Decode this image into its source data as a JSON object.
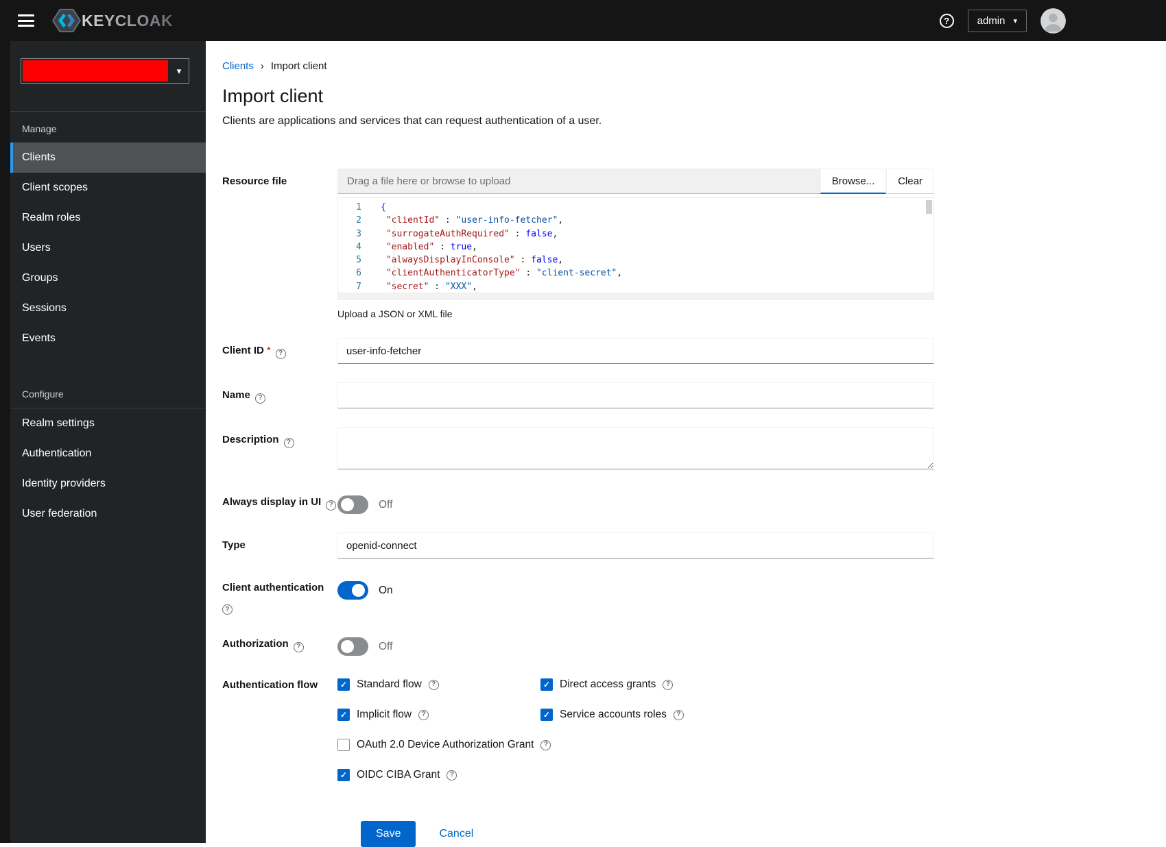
{
  "colors": {
    "accent": "#0066cc",
    "masthead_bg": "#151515",
    "sidebar_bg": "#212427",
    "sidebar_selected_bg": "#4f5255",
    "sidebar_selected_border": "#2b9af3",
    "realm_redaction": "#fe0000",
    "toggle_on": "#0066cc",
    "toggle_off": "#8a8d90",
    "required_star": "#c9190b",
    "code_key": "#a31515",
    "code_string": "#0451a5",
    "code_keyword": "#0000ff",
    "code_brace": "#0431fa",
    "code_line_number": "#237893"
  },
  "icons": {
    "caret_down": "▾",
    "breadcrumb_chevron": "›",
    "help": "?",
    "check": "✓"
  },
  "header": {
    "brand": "KEYCLOAK",
    "user_menu_label": "admin"
  },
  "sidebar": {
    "sections": [
      {
        "title": "Manage",
        "items": [
          {
            "label": "Clients",
            "selected": true
          },
          {
            "label": "Client scopes"
          },
          {
            "label": "Realm roles"
          },
          {
            "label": "Users"
          },
          {
            "label": "Groups"
          },
          {
            "label": "Sessions"
          },
          {
            "label": "Events"
          }
        ]
      },
      {
        "title": "Configure",
        "items": [
          {
            "label": "Realm settings"
          },
          {
            "label": "Authentication"
          },
          {
            "label": "Identity providers"
          },
          {
            "label": "User federation"
          }
        ]
      }
    ]
  },
  "breadcrumb": {
    "parent": "Clients",
    "current": "Import client"
  },
  "page": {
    "title": "Import client",
    "subtitle": "Clients are applications and services that can request authentication of a user."
  },
  "form": {
    "resource_file": {
      "label": "Resource file",
      "placeholder": "Drag a file here or browse to upload",
      "browse_label": "Browse...",
      "clear_label": "Clear",
      "helper_text": "Upload a JSON or XML file",
      "code_lines": [
        {
          "num": "1",
          "tokens": [
            {
              "t": "b",
              "v": "{"
            }
          ]
        },
        {
          "num": "2",
          "tokens": [
            {
              "t": "p",
              "v": " "
            },
            {
              "t": "k",
              "v": "\"clientId\""
            },
            {
              "t": "p",
              "v": " : "
            },
            {
              "t": "s",
              "v": "\"user-info-fetcher\""
            },
            {
              "t": "p",
              "v": ","
            }
          ]
        },
        {
          "num": "3",
          "tokens": [
            {
              "t": "p",
              "v": " "
            },
            {
              "t": "k",
              "v": "\"surrogateAuthRequired\""
            },
            {
              "t": "p",
              "v": " : "
            },
            {
              "t": "w",
              "v": "false"
            },
            {
              "t": "p",
              "v": ","
            }
          ]
        },
        {
          "num": "4",
          "tokens": [
            {
              "t": "p",
              "v": " "
            },
            {
              "t": "k",
              "v": "\"enabled\""
            },
            {
              "t": "p",
              "v": " : "
            },
            {
              "t": "w",
              "v": "true"
            },
            {
              "t": "p",
              "v": ","
            }
          ]
        },
        {
          "num": "5",
          "tokens": [
            {
              "t": "p",
              "v": " "
            },
            {
              "t": "k",
              "v": "\"alwaysDisplayInConsole\""
            },
            {
              "t": "p",
              "v": " : "
            },
            {
              "t": "w",
              "v": "false"
            },
            {
              "t": "p",
              "v": ","
            }
          ]
        },
        {
          "num": "6",
          "tokens": [
            {
              "t": "p",
              "v": " "
            },
            {
              "t": "k",
              "v": "\"clientAuthenticatorType\""
            },
            {
              "t": "p",
              "v": " : "
            },
            {
              "t": "s",
              "v": "\"client-secret\""
            },
            {
              "t": "p",
              "v": ","
            }
          ]
        },
        {
          "num": "7",
          "tokens": [
            {
              "t": "p",
              "v": " "
            },
            {
              "t": "k",
              "v": "\"secret\""
            },
            {
              "t": "p",
              "v": " : "
            },
            {
              "t": "s",
              "v": "\"XXX\""
            },
            {
              "t": "p",
              "v": ","
            }
          ]
        }
      ]
    },
    "client_id": {
      "label": "Client ID",
      "required_indicator": "*",
      "value": "user-info-fetcher"
    },
    "name": {
      "label": "Name",
      "value": ""
    },
    "description": {
      "label": "Description",
      "value": ""
    },
    "always_display_in_ui": {
      "label": "Always display in UI",
      "state": "Off"
    },
    "type": {
      "label": "Type",
      "value": "openid-connect"
    },
    "client_authentication": {
      "label": "Client authentication",
      "state": "On"
    },
    "authorization": {
      "label": "Authorization",
      "state": "Off"
    },
    "authentication_flow": {
      "label": "Authentication flow",
      "options": [
        {
          "label": "Standard flow",
          "checked": true
        },
        {
          "label": "Direct access grants",
          "checked": true
        },
        {
          "label": "Implicit flow",
          "checked": true
        },
        {
          "label": "Service accounts roles",
          "checked": true
        },
        {
          "label": "OAuth 2.0 Device Authorization Grant",
          "checked": false
        },
        {
          "label": "OIDC CIBA Grant",
          "checked": true
        }
      ]
    },
    "actions": {
      "save_label": "Save",
      "cancel_label": "Cancel"
    }
  }
}
